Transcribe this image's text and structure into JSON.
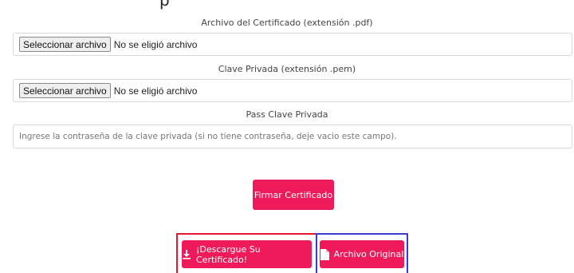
{
  "top_partial_text": "p",
  "certificate": {
    "label": "Archivo del Certificado (extensión .pdf)",
    "button": "Seleccionar archivo",
    "status": "No se eligió archivo"
  },
  "private_key": {
    "label": "Clave Privada (extensión .pem)",
    "button": "Seleccionar archivo",
    "status": "No se eligió archivo"
  },
  "password": {
    "label": "Pass Clave Privada",
    "placeholder": "Ingrese la contraseña de la clave privada (si no tiene contraseña, deje vacio este campo)."
  },
  "sign_button": "Firmar Certificado",
  "download_button": "¡Descargue Su Certificado!",
  "original_button": "Archivo Original",
  "colors": {
    "accent": "#ef1a5a",
    "highlight_red": "#e8162e",
    "highlight_blue": "#3a3bd0"
  },
  "icons": {
    "download": "download-icon",
    "original": "file-icon"
  }
}
